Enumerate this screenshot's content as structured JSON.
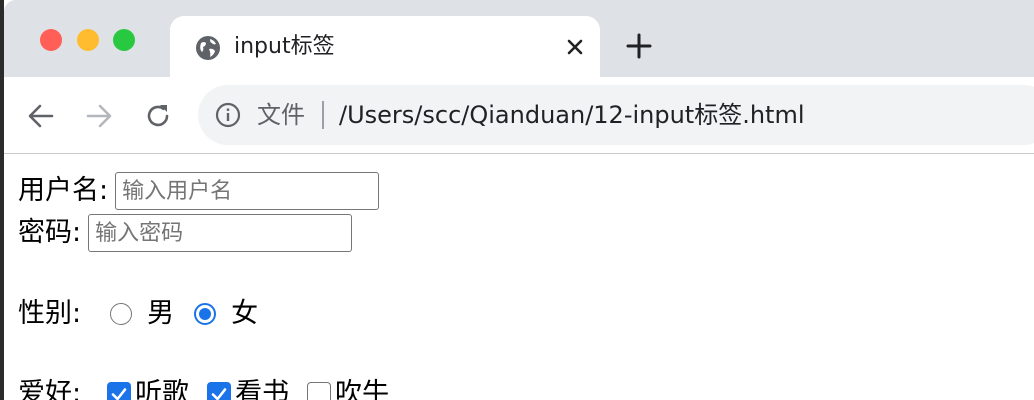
{
  "tab": {
    "title": "input标签",
    "favicon": "globe-icon",
    "close": "close-icon"
  },
  "new_tab": "plus-icon",
  "toolbar": {
    "back": "arrow-left-icon",
    "forward": "arrow-right-icon",
    "reload": "reload-icon",
    "omnibox": {
      "label": "文件",
      "url": "/Users/scc/Qianduan/12-input标签.html"
    }
  },
  "form": {
    "username": {
      "label": "用户名:",
      "placeholder": "输入用户名"
    },
    "password": {
      "label": "密码:",
      "placeholder": "输入密码"
    },
    "gender": {
      "label": "性别:",
      "options": [
        {
          "label": "男",
          "checked": false
        },
        {
          "label": "女",
          "checked": true
        }
      ]
    },
    "hobbies": {
      "label": "爱好:",
      "options": [
        {
          "label": "听歌",
          "checked": true
        },
        {
          "label": "看书",
          "checked": true
        },
        {
          "label": "吹牛",
          "checked": false
        }
      ]
    }
  },
  "colors": {
    "accent": "#1a73e8",
    "tabstrip": "#dee1e6",
    "omnibox": "#f1f3f4"
  }
}
